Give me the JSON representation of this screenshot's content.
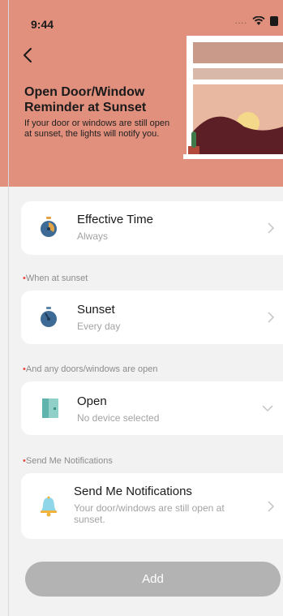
{
  "status_bar": {
    "time": "9:44",
    "signal": "....",
    "wifi_icon": "wifi-icon",
    "battery_icon": "battery-icon"
  },
  "header": {
    "title": "Open Door/Window Reminder at Sunset",
    "description": "If your door or windows are still open at sunset, the lights will notify you.",
    "back_icon": "chevron-left-icon",
    "background_color": "#e0907d"
  },
  "effective_time": {
    "title": "Effective Time",
    "value": "Always",
    "icon": "timer-icon"
  },
  "sunset_section": {
    "label_marker": "•",
    "label": "When at sunset",
    "title": "Sunset",
    "value": "Every day",
    "icon": "timer-icon"
  },
  "door_section": {
    "label_marker": "•",
    "label": "And any doors/windows are open",
    "title": "Open",
    "value": "No device selected",
    "icon": "door-sensor-icon"
  },
  "notify_section": {
    "label_marker": "•",
    "label": "Send Me Notifications",
    "title": "Send Me Notifications",
    "value": "Your door/windows are still open at sunset.",
    "icon": "bell-icon"
  },
  "add_button": {
    "label": "Add"
  },
  "colors": {
    "accent_red": "#e94a3f",
    "button_disabled": "#b3b3b3",
    "timer_blue": "#3d6b95"
  }
}
